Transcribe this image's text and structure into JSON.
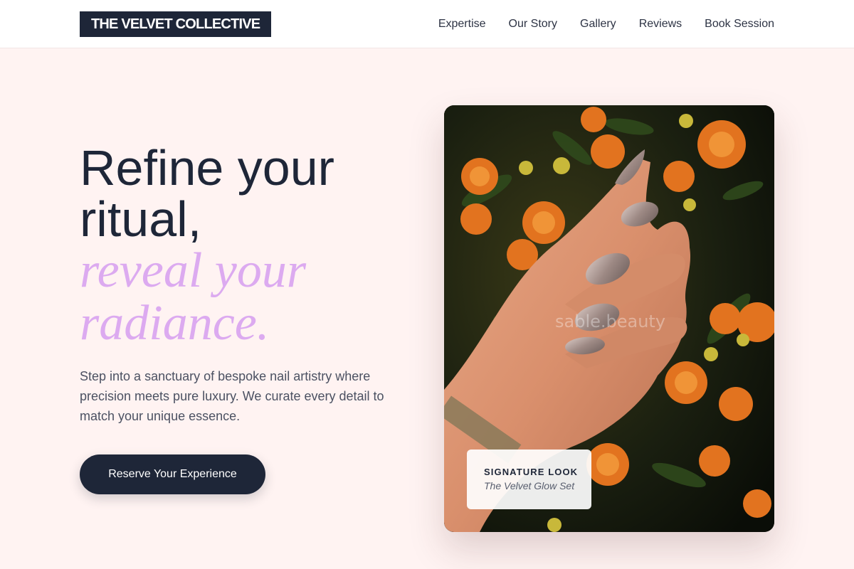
{
  "brand": {
    "name": "THE VELVET COLLECTIVE"
  },
  "nav": {
    "items": [
      {
        "label": "Expertise"
      },
      {
        "label": "Our Story"
      },
      {
        "label": "Gallery"
      },
      {
        "label": "Reviews"
      },
      {
        "label": "Book Session"
      }
    ]
  },
  "hero": {
    "headline_line1": "Refine your",
    "headline_line2": "ritual,",
    "accent_line1": "reveal your",
    "accent_line2": "radiance.",
    "intro": "Step into a sanctuary of bespoke nail artistry where precision meets pure luxury. We curate every detail to match your unique essence.",
    "cta_label": "Reserve Your Experience"
  },
  "feature": {
    "watermark": "sable.beauty",
    "caption_title": "SIGNATURE LOOK",
    "caption_subtitle": "The Velvet Glow Set"
  },
  "colors": {
    "page_background": "#fff3f2",
    "navy": "#1e2638",
    "accent_lilac": "#dcaaf0"
  }
}
